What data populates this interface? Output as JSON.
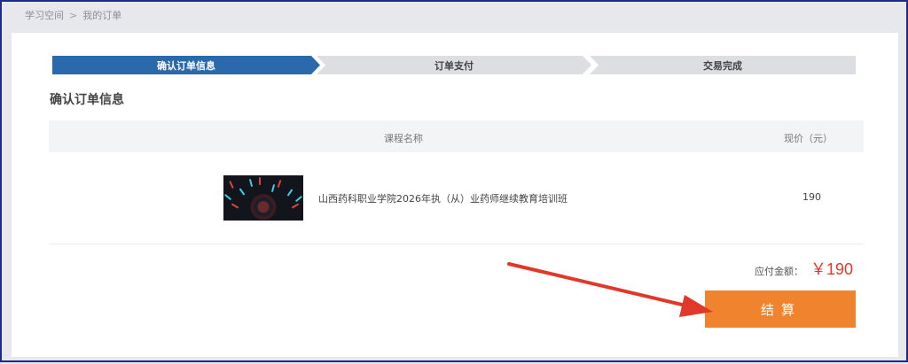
{
  "breadcrumb": {
    "root": "学习空间",
    "separator": ">",
    "current": "我的订单"
  },
  "steps": [
    "确认订单信息",
    "订单支付",
    "交易完成"
  ],
  "section_title": "确认订单信息",
  "table": {
    "headers": {
      "name": "课程名称",
      "price": "现价（元）"
    },
    "rows": [
      {
        "name": "山西药科职业学院2026年执（从）业药师继续教育培训班",
        "price": "190"
      }
    ]
  },
  "total": {
    "label": "应付金额：",
    "value": "￥190"
  },
  "checkout_label": "结算",
  "colors": {
    "active_step": "#2a69ab",
    "checkout": "#f0832e",
    "price": "#e0392b",
    "annotation_arrow": "#e0392b"
  }
}
